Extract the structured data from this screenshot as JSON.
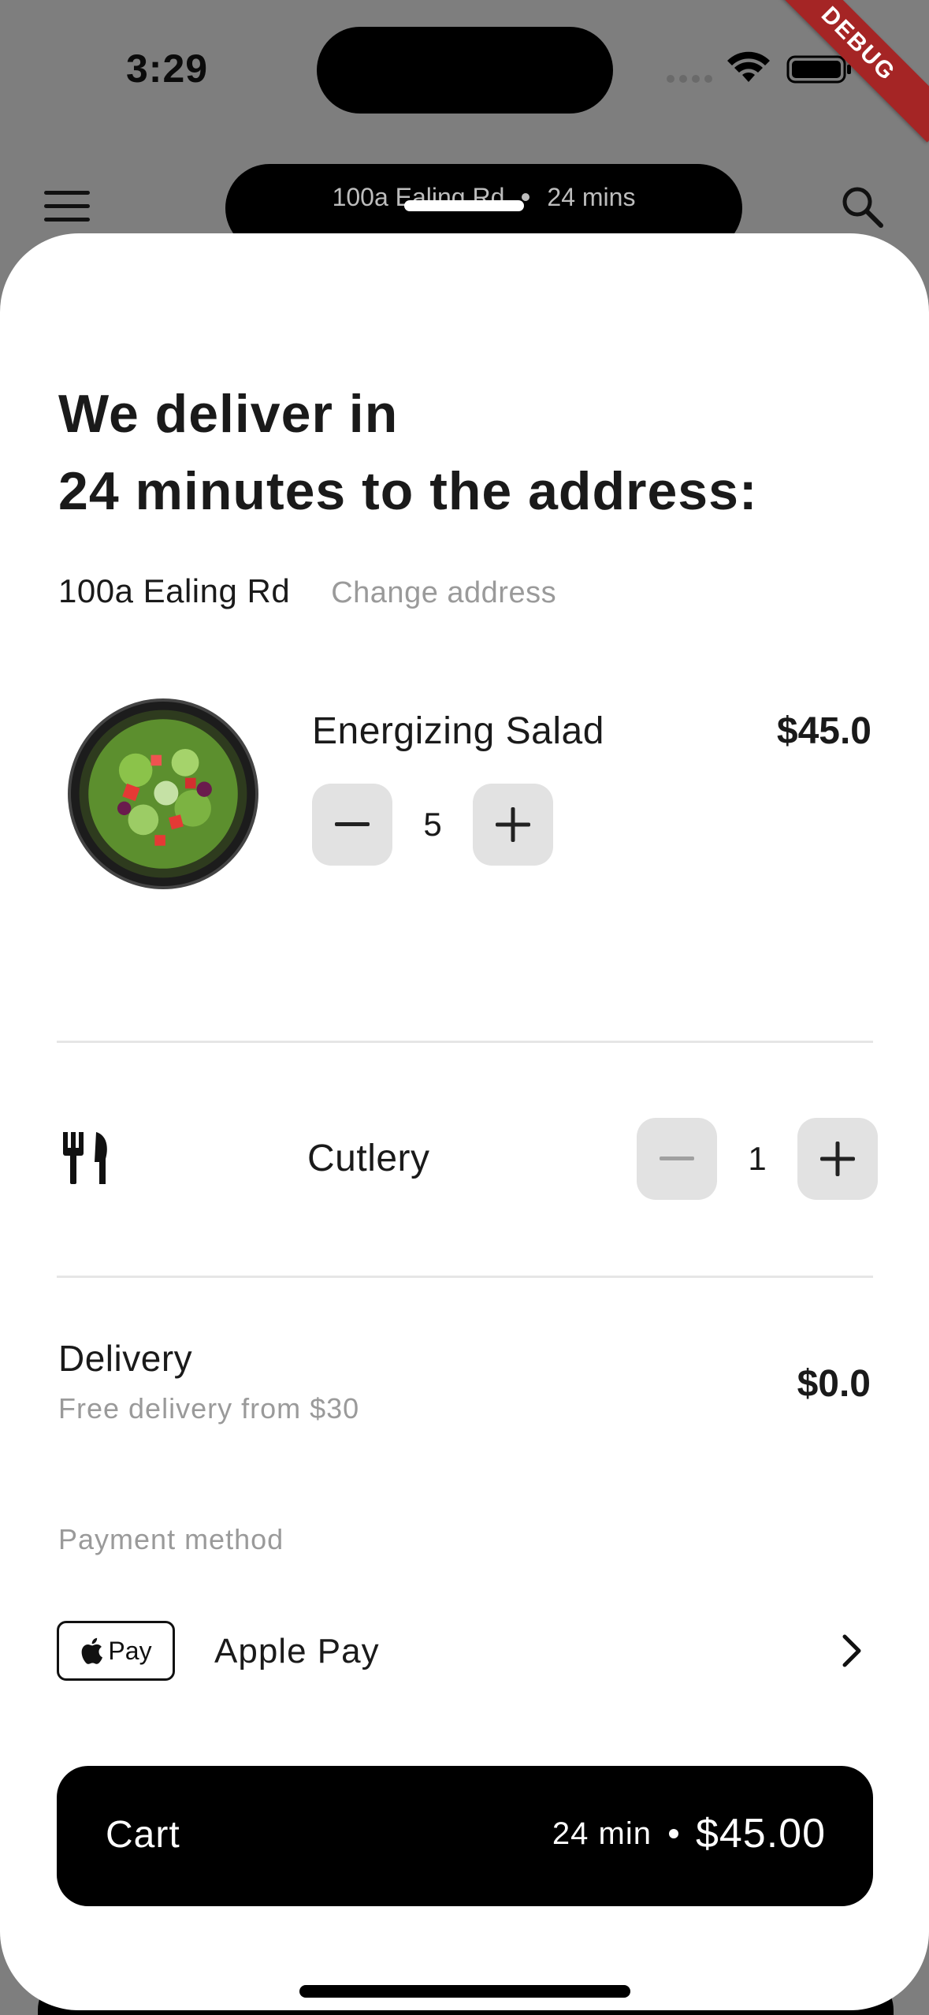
{
  "status_bar": {
    "time": "3:29",
    "debug_label": "DEBUG"
  },
  "app_bar": {
    "address": "100a Ealing Rd",
    "eta": "24 mins"
  },
  "sheet": {
    "heading_line1": "We deliver in",
    "heading_line2": "24 minutes to the address:",
    "address": "100a Ealing Rd",
    "change_address_label": "Change address",
    "item": {
      "name": "Energizing Salad",
      "price": "$45.0",
      "quantity": "5",
      "image_icon": "salad-bowl-image"
    },
    "cutlery": {
      "label": "Cutlery",
      "quantity": "1",
      "icon": "fork-knife-icon"
    },
    "delivery": {
      "title": "Delivery",
      "subtitle": "Free delivery from $30",
      "price": "$0.0"
    },
    "payment": {
      "section_label": "Payment method",
      "badge_text": "Pay",
      "method_name": "Apple Pay"
    },
    "cart": {
      "label": "Cart",
      "time": "24 min",
      "total": "$45.00"
    }
  },
  "colors": {
    "accent": "#000000",
    "muted_text": "#9a9a9a",
    "stepper_bg": "#e2e2e2",
    "debug_banner": "#a52525"
  }
}
